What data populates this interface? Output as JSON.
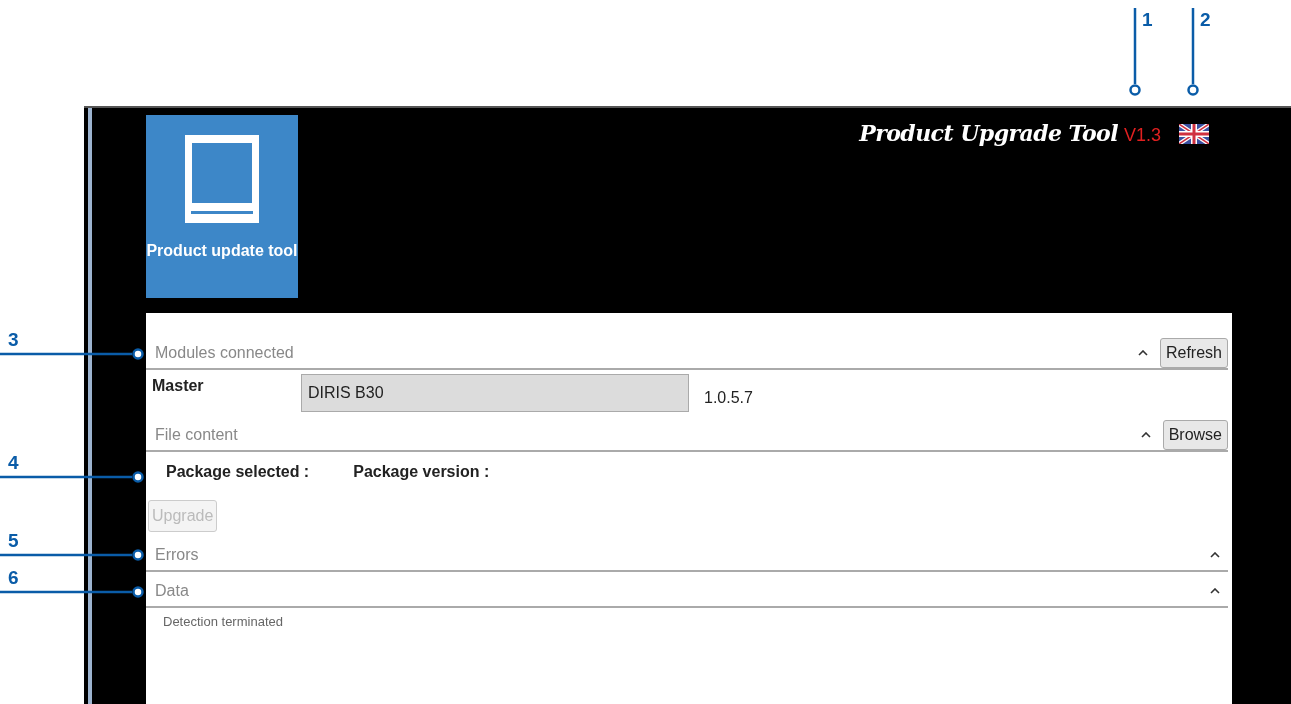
{
  "window": {
    "tile_label": "Product update tool",
    "title": "Product Upgrade Tool",
    "version": "V1.3"
  },
  "sections": [
    {
      "kind": "modules",
      "title": "Modules connected",
      "expanded": true,
      "button": "Refresh",
      "rows": [
        {
          "label": "Master",
          "device": "DIRIS B30",
          "version": "1.0.5.7"
        }
      ]
    },
    {
      "kind": "file",
      "title": "File content",
      "expanded": true,
      "button": "Browse",
      "fields": [
        "Package selected :",
        "Package version :"
      ],
      "action": {
        "label": "Upgrade",
        "disabled": true
      }
    },
    {
      "kind": "errors",
      "title": "Errors",
      "expanded": true
    },
    {
      "kind": "data",
      "title": "Data",
      "expanded": true,
      "messages": [
        "Detection terminated"
      ]
    }
  ],
  "callouts": [
    {
      "label": "1"
    },
    {
      "label": "2"
    },
    {
      "label": "3"
    },
    {
      "label": "4"
    },
    {
      "label": "5"
    },
    {
      "label": "6"
    }
  ]
}
